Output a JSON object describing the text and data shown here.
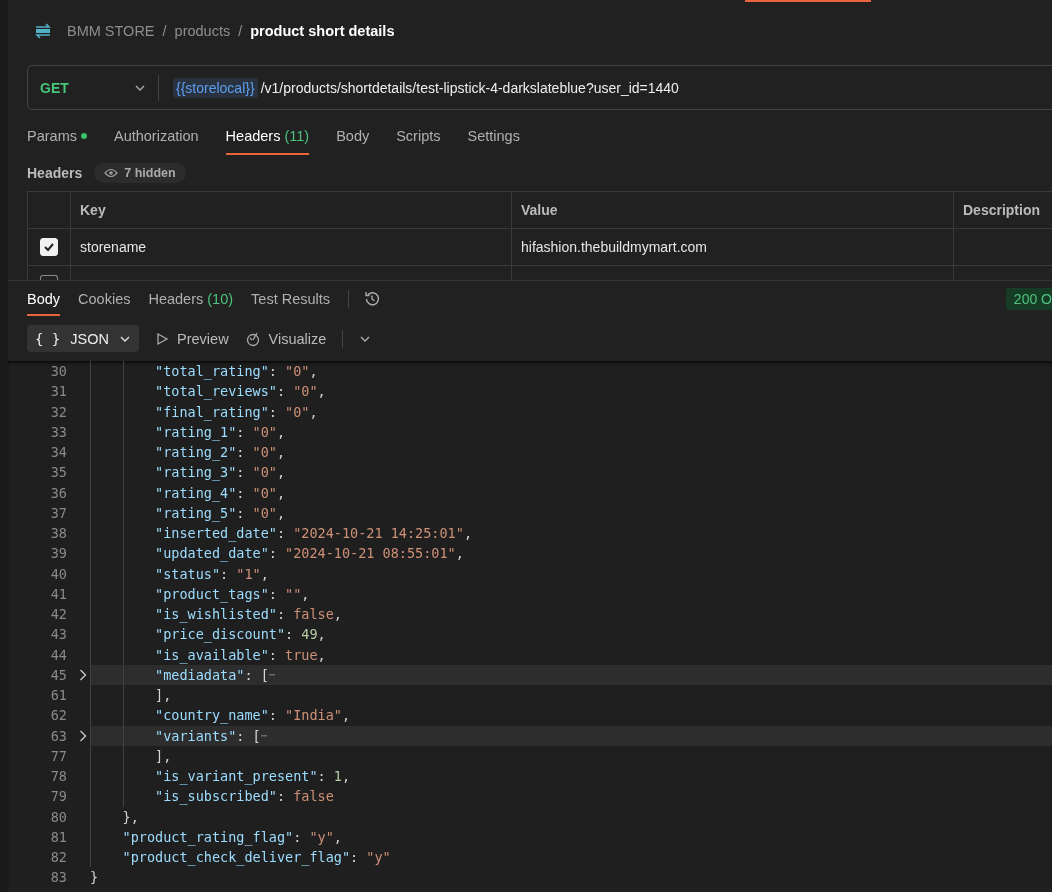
{
  "breadcrumb": {
    "items": [
      "BMM STORE",
      "products"
    ],
    "separator": "/",
    "current": "product short details"
  },
  "request": {
    "method": "GET",
    "variable": "{{storelocal}}",
    "path": "/v1/products/shortdetails/test-lipstick-4-darkslateblue?user_id=1440"
  },
  "request_tabs": [
    {
      "label": "Params",
      "dot": true,
      "selected": false
    },
    {
      "label": "Authorization",
      "dot": false,
      "selected": false
    },
    {
      "label": "Headers",
      "count": "(11)",
      "dot": false,
      "selected": true
    },
    {
      "label": "Body",
      "dot": false,
      "selected": false
    },
    {
      "label": "Scripts",
      "dot": false,
      "selected": false
    },
    {
      "label": "Settings",
      "dot": false,
      "selected": false
    }
  ],
  "headers_section": {
    "title": "Headers",
    "hidden_badge": "7 hidden"
  },
  "headers_table": {
    "columns": [
      "Key",
      "Value",
      "Description"
    ],
    "rows": [
      {
        "checked": true,
        "key": "storename",
        "value": "hifashion.thebuildmymart.com"
      },
      {
        "checked": false
      }
    ]
  },
  "response_tabs": [
    {
      "label": "Body",
      "selected": true
    },
    {
      "label": "Cookies",
      "selected": false
    },
    {
      "label": "Headers",
      "count": "(10)",
      "selected": false
    },
    {
      "label": "Test Results",
      "selected": false
    }
  ],
  "status": "200 O",
  "format_button": {
    "icon": "{ }",
    "label": "JSON"
  },
  "view_buttons": [
    "Preview",
    "Visualize"
  ],
  "code_lines": [
    {
      "children": [
        {
          "children": [
            {
              "number": "30",
              "tokens": [
                {
                  "kind": "key",
                  "text": "\"total_rating\""
                },
                {
                  "kind": "punct",
                  "text": ": "
                },
                {
                  "kind": "string",
                  "text": "\"0\""
                },
                {
                  "kind": "punct",
                  "text": ","
                }
              ]
            },
            {
              "number": "31",
              "tokens": [
                {
                  "kind": "key",
                  "text": "\"total_reviews\""
                },
                {
                  "kind": "punct",
                  "text": ": "
                },
                {
                  "kind": "string",
                  "text": "\"0\""
                },
                {
                  "kind": "punct",
                  "text": ","
                }
              ]
            },
            {
              "number": "32",
              "tokens": [
                {
                  "kind": "key",
                  "text": "\"final_rating\""
                },
                {
                  "kind": "punct",
                  "text": ": "
                },
                {
                  "kind": "string",
                  "text": "\"0\""
                },
                {
                  "kind": "punct",
                  "text": ","
                }
              ]
            },
            {
              "number": "33",
              "tokens": [
                {
                  "kind": "key",
                  "text": "\"rating_1\""
                },
                {
                  "kind": "punct",
                  "text": ": "
                },
                {
                  "kind": "string",
                  "text": "\"0\""
                },
                {
                  "kind": "punct",
                  "text": ","
                }
              ]
            },
            {
              "number": "34",
              "tokens": [
                {
                  "kind": "key",
                  "text": "\"rating_2\""
                },
                {
                  "kind": "punct",
                  "text": ": "
                },
                {
                  "kind": "string",
                  "text": "\"0\""
                },
                {
                  "kind": "punct",
                  "text": ","
                }
              ]
            },
            {
              "number": "35",
              "tokens": [
                {
                  "kind": "key",
                  "text": "\"rating_3\""
                },
                {
                  "kind": "punct",
                  "text": ": "
                },
                {
                  "kind": "string",
                  "text": "\"0\""
                },
                {
                  "kind": "punct",
                  "text": ","
                }
              ]
            },
            {
              "number": "36",
              "tokens": [
                {
                  "kind": "key",
                  "text": "\"rating_4\""
                },
                {
                  "kind": "punct",
                  "text": ": "
                },
                {
                  "kind": "string",
                  "text": "\"0\""
                },
                {
                  "kind": "punct",
                  "text": ","
                }
              ]
            },
            {
              "number": "37",
              "tokens": [
                {
                  "kind": "key",
                  "text": "\"rating_5\""
                },
                {
                  "kind": "punct",
                  "text": ": "
                },
                {
                  "kind": "string",
                  "text": "\"0\""
                },
                {
                  "kind": "punct",
                  "text": ","
                }
              ]
            },
            {
              "number": "38",
              "tokens": [
                {
                  "kind": "key",
                  "text": "\"inserted_date\""
                },
                {
                  "kind": "punct",
                  "text": ": "
                },
                {
                  "kind": "string",
                  "text": "\"2024-10-21 14:25:01\""
                },
                {
                  "kind": "punct",
                  "text": ","
                }
              ]
            },
            {
              "number": "39",
              "tokens": [
                {
                  "kind": "key",
                  "text": "\"updated_date\""
                },
                {
                  "kind": "punct",
                  "text": ": "
                },
                {
                  "kind": "string",
                  "text": "\"2024-10-21 08:55:01\""
                },
                {
                  "kind": "punct",
                  "text": ","
                }
              ]
            },
            {
              "number": "40",
              "tokens": [
                {
                  "kind": "key",
                  "text": "\"status\""
                },
                {
                  "kind": "punct",
                  "text": ": "
                },
                {
                  "kind": "string",
                  "text": "\"1\""
                },
                {
                  "kind": "punct",
                  "text": ","
                }
              ]
            },
            {
              "number": "41",
              "tokens": [
                {
                  "kind": "key",
                  "text": "\"product_tags\""
                },
                {
                  "kind": "punct",
                  "text": ": "
                },
                {
                  "kind": "string",
                  "text": "\"\""
                },
                {
                  "kind": "punct",
                  "text": ","
                }
              ]
            },
            {
              "number": "42",
              "tokens": [
                {
                  "kind": "key",
                  "text": "\"is_wishlisted\""
                },
                {
                  "kind": "punct",
                  "text": ": "
                },
                {
                  "kind": "boolean",
                  "text": "false"
                },
                {
                  "kind": "punct",
                  "text": ","
                }
              ]
            },
            {
              "number": "43",
              "tokens": [
                {
                  "kind": "key",
                  "text": "\"price_discount\""
                },
                {
                  "kind": "punct",
                  "text": ": "
                },
                {
                  "kind": "number",
                  "text": "49"
                },
                {
                  "kind": "punct",
                  "text": ","
                }
              ]
            },
            {
              "number": "44",
              "tokens": [
                {
                  "kind": "key",
                  "text": "\"is_available\""
                },
                {
                  "kind": "punct",
                  "text": ": "
                },
                {
                  "kind": "boolean",
                  "text": "true"
                },
                {
                  "kind": "punct",
                  "text": ","
                }
              ]
            },
            {
              "number": "45",
              "folded": true,
              "tokens": [
                {
                  "kind": "key",
                  "text": "\"mediadata\""
                },
                {
                  "kind": "punct",
                  "text": ": ["
                },
                {
                  "kind": "ellipsis",
                  "text": "⋯"
                }
              ]
            },
            {
              "number": "61",
              "tokens": [
                {
                  "kind": "punct",
                  "text": "],"
                }
              ]
            },
            {
              "number": "62",
              "tokens": [
                {
                  "kind": "key",
                  "text": "\"country_name\""
                },
                {
                  "kind": "punct",
                  "text": ": "
                },
                {
                  "kind": "string",
                  "text": "\"India\""
                },
                {
                  "kind": "punct",
                  "text": ","
                }
              ]
            },
            {
              "number": "63",
              "folded": true,
              "tokens": [
                {
                  "kind": "key",
                  "text": "\"variants\""
                },
                {
                  "kind": "punct",
                  "text": ": ["
                },
                {
                  "kind": "ellipsis",
                  "text": "⋯"
                }
              ]
            },
            {
              "number": "77",
              "tokens": [
                {
                  "kind": "punct",
                  "text": "],"
                }
              ]
            },
            {
              "number": "78",
              "tokens": [
                {
                  "kind": "key",
                  "text": "\"is_variant_present\""
                },
                {
                  "kind": "punct",
                  "text": ": "
                },
                {
                  "kind": "number",
                  "text": "1"
                },
                {
                  "kind": "punct",
                  "text": ","
                }
              ]
            },
            {
              "number": "79",
              "tokens": [
                {
                  "kind": "key",
                  "text": "\"is_subscribed\""
                },
                {
                  "kind": "punct",
                  "text": ": "
                },
                {
                  "kind": "boolean",
                  "text": "false"
                }
              ]
            }
          ]
        },
        {
          "number": "80",
          "tokens": [
            {
              "kind": "punct",
              "text": "},"
            }
          ]
        },
        {
          "number": "81",
          "tokens": [
            {
              "kind": "key",
              "text": "\"product_rating_flag\""
            },
            {
              "kind": "punct",
              "text": ": "
            },
            {
              "kind": "string",
              "text": "\"y\""
            },
            {
              "kind": "punct",
              "text": ","
            }
          ]
        },
        {
          "number": "82",
          "tokens": [
            {
              "kind": "key",
              "text": "\"product_check_deliver_flag\""
            },
            {
              "kind": "punct",
              "text": ": "
            },
            {
              "kind": "string",
              "text": "\"y\""
            }
          ]
        }
      ]
    },
    {
      "number": "83",
      "tokens": [
        {
          "kind": "punct",
          "text": "}"
        }
      ]
    }
  ]
}
